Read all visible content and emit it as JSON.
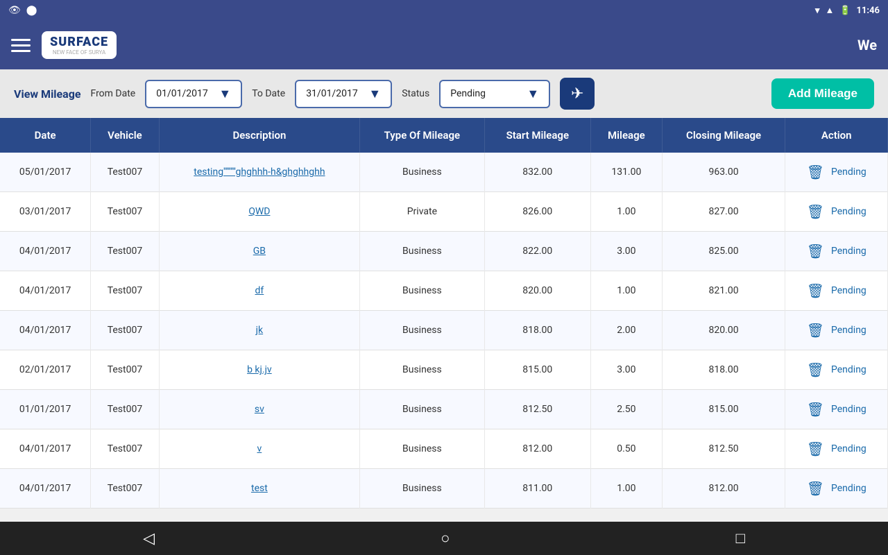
{
  "statusBar": {
    "time": "11:46",
    "icons": [
      "eye",
      "android",
      "wifi",
      "signal",
      "battery"
    ]
  },
  "navbar": {
    "logoText": "SURFACE",
    "logoSub": "NEW FACE OF SURYA",
    "pageTitle": "We"
  },
  "filterBar": {
    "viewLabel": "View Mileage",
    "fromDateLabel": "From Date",
    "fromDateValue": "01/01/2017",
    "toDateLabel": "To Date",
    "toDateValue": "31/01/2017",
    "statusLabel": "Status",
    "statusValue": "Pending",
    "addButtonLabel": "Add Mileage"
  },
  "table": {
    "headers": [
      "Date",
      "Vehicle",
      "Description",
      "Type Of Mileage",
      "Start Mileage",
      "Mileage",
      "Closing Mileage",
      "Action"
    ],
    "rows": [
      {
        "date": "05/01/2017",
        "vehicle": "Test007",
        "description": "testing''''''''''ghghhh-h&ghghhghh",
        "type": "Business",
        "start": "832.00",
        "mileage": "131.00",
        "closing": "963.00",
        "status": "Pending"
      },
      {
        "date": "03/01/2017",
        "vehicle": "Test007",
        "description": "QWD",
        "type": "Private",
        "start": "826.00",
        "mileage": "1.00",
        "closing": "827.00",
        "status": "Pending"
      },
      {
        "date": "04/01/2017",
        "vehicle": "Test007",
        "description": "GB",
        "type": "Business",
        "start": "822.00",
        "mileage": "3.00",
        "closing": "825.00",
        "status": "Pending"
      },
      {
        "date": "04/01/2017",
        "vehicle": "Test007",
        "description": "df",
        "type": "Business",
        "start": "820.00",
        "mileage": "1.00",
        "closing": "821.00",
        "status": "Pending"
      },
      {
        "date": "04/01/2017",
        "vehicle": "Test007",
        "description": "jk",
        "type": "Business",
        "start": "818.00",
        "mileage": "2.00",
        "closing": "820.00",
        "status": "Pending"
      },
      {
        "date": "02/01/2017",
        "vehicle": "Test007",
        "description": "b kj.jv",
        "type": "Business",
        "start": "815.00",
        "mileage": "3.00",
        "closing": "818.00",
        "status": "Pending"
      },
      {
        "date": "01/01/2017",
        "vehicle": "Test007",
        "description": "sv",
        "type": "Business",
        "start": "812.50",
        "mileage": "2.50",
        "closing": "815.00",
        "status": "Pending"
      },
      {
        "date": "04/01/2017",
        "vehicle": "Test007",
        "description": "v",
        "type": "Business",
        "start": "812.00",
        "mileage": "0.50",
        "closing": "812.50",
        "status": "Pending"
      },
      {
        "date": "04/01/2017",
        "vehicle": "Test007",
        "description": "test",
        "type": "Business",
        "start": "811.00",
        "mileage": "1.00",
        "closing": "812.00",
        "status": "Pending"
      }
    ]
  },
  "bottomNav": {
    "backLabel": "◁",
    "homeLabel": "○",
    "recentLabel": "□"
  }
}
